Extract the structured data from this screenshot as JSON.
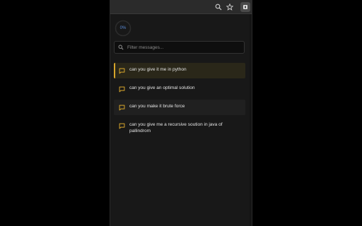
{
  "progress": {
    "label": "0%",
    "value": 0
  },
  "filter": {
    "placeholder": "Filter messages..."
  },
  "messages": [
    {
      "text": "can you give it me in python"
    },
    {
      "text": "can you give an optimal solution"
    },
    {
      "text": "can you make it brute force"
    },
    {
      "text": "can you give me a recursive soution in java of pallindrom"
    }
  ],
  "toolbar": {
    "zoom_icon": "zoom-icon",
    "star_icon": "star-icon",
    "extension_icon": "extension-icon"
  },
  "colors": {
    "accent": "#d6a52b",
    "progress": "#5b8dd9",
    "background": "#181818"
  }
}
